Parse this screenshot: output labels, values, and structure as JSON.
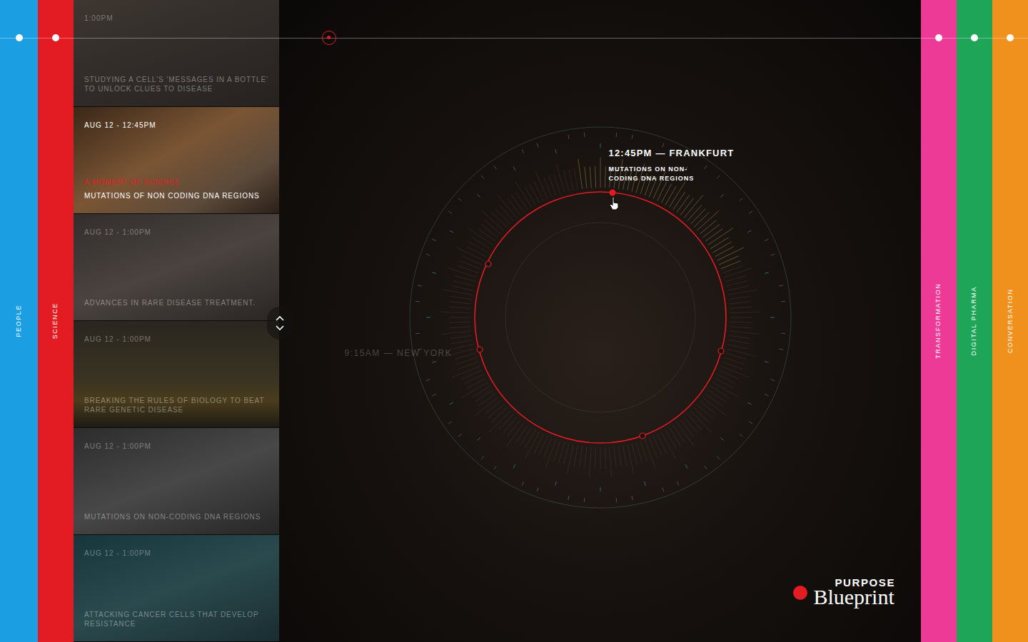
{
  "left_categories": [
    {
      "label": "PEOPLE",
      "color": "#1c9fe2"
    },
    {
      "label": "SCIENCE",
      "color": "#e31c23"
    }
  ],
  "right_categories": [
    {
      "label": "TRANSFORMATION",
      "color": "#ee3a97"
    },
    {
      "label": "DIGITAL PHARMA",
      "color": "#1fa558"
    },
    {
      "label": "CONVERSATION",
      "color": "#f0911e"
    }
  ],
  "feed": {
    "items": [
      {
        "date": "1:00PM",
        "title": "STUDYING A CELL'S 'MESSAGES IN A BOTTLE' TO UNLOCK CLUES TO DISEASE",
        "selected": false
      },
      {
        "date": "AUG 12 - 12:45PM",
        "category": "A MOMENT OF SCIENCE",
        "title": "MUTATIONS OF NON CODING DNA REGIONS",
        "selected": true
      },
      {
        "date": "AUG 12 - 1:00PM",
        "title": "ADVANCES IN RARE DISEASE TREATMENT.",
        "selected": false
      },
      {
        "date": "AUG 12 - 1:00PM",
        "title": "BREAKING THE RULES OF BIOLOGY TO BEAT RARE GENETIC DISEASE",
        "selected": false
      },
      {
        "date": "AUG 12 - 1:00PM",
        "title": "MUTATIONS ON NON-CODING DNA REGIONS",
        "selected": false
      },
      {
        "date": "AUG 12 - 1:00PM",
        "title": "ATTACKING CANCER CELLS THAT DEVELOP RESISTANCE",
        "selected": false
      }
    ]
  },
  "dial": {
    "active": {
      "time": "12:45PM — FRANKFURT",
      "title": "MUTATIONS ON NON-CODING DNA REGIONS"
    },
    "other_label": "9:15AM — NEW YORK"
  },
  "logo": {
    "top": "PURPOSE",
    "bottom": "Blueprint"
  }
}
